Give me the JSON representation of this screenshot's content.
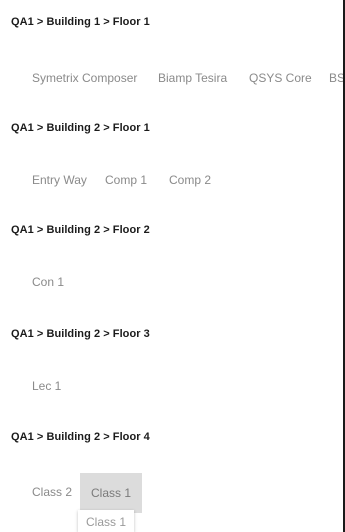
{
  "sections": [
    {
      "breadcrumb": "QA1 > Building 1 > Floor 1",
      "devices": [
        "Symetrix Composer",
        "Biamp Tesira",
        "QSYS Core",
        "BSS"
      ]
    },
    {
      "breadcrumb": "QA1 > Building 2 > Floor 1",
      "devices": [
        "Entry Way",
        "Comp 1",
        "Comp 2"
      ]
    },
    {
      "breadcrumb": "QA1 > Building 2 > Floor 2",
      "devices": [
        "Con 1"
      ]
    },
    {
      "breadcrumb": "QA1 > Building 2 > Floor 3",
      "devices": [
        "Lec 1"
      ]
    },
    {
      "breadcrumb": "QA1 > Building 2 > Floor 4",
      "devices": [
        "Class 2",
        "Class 1"
      ],
      "selected_device": "Class 1"
    }
  ],
  "drag_ghost": {
    "label": "Class 1"
  }
}
